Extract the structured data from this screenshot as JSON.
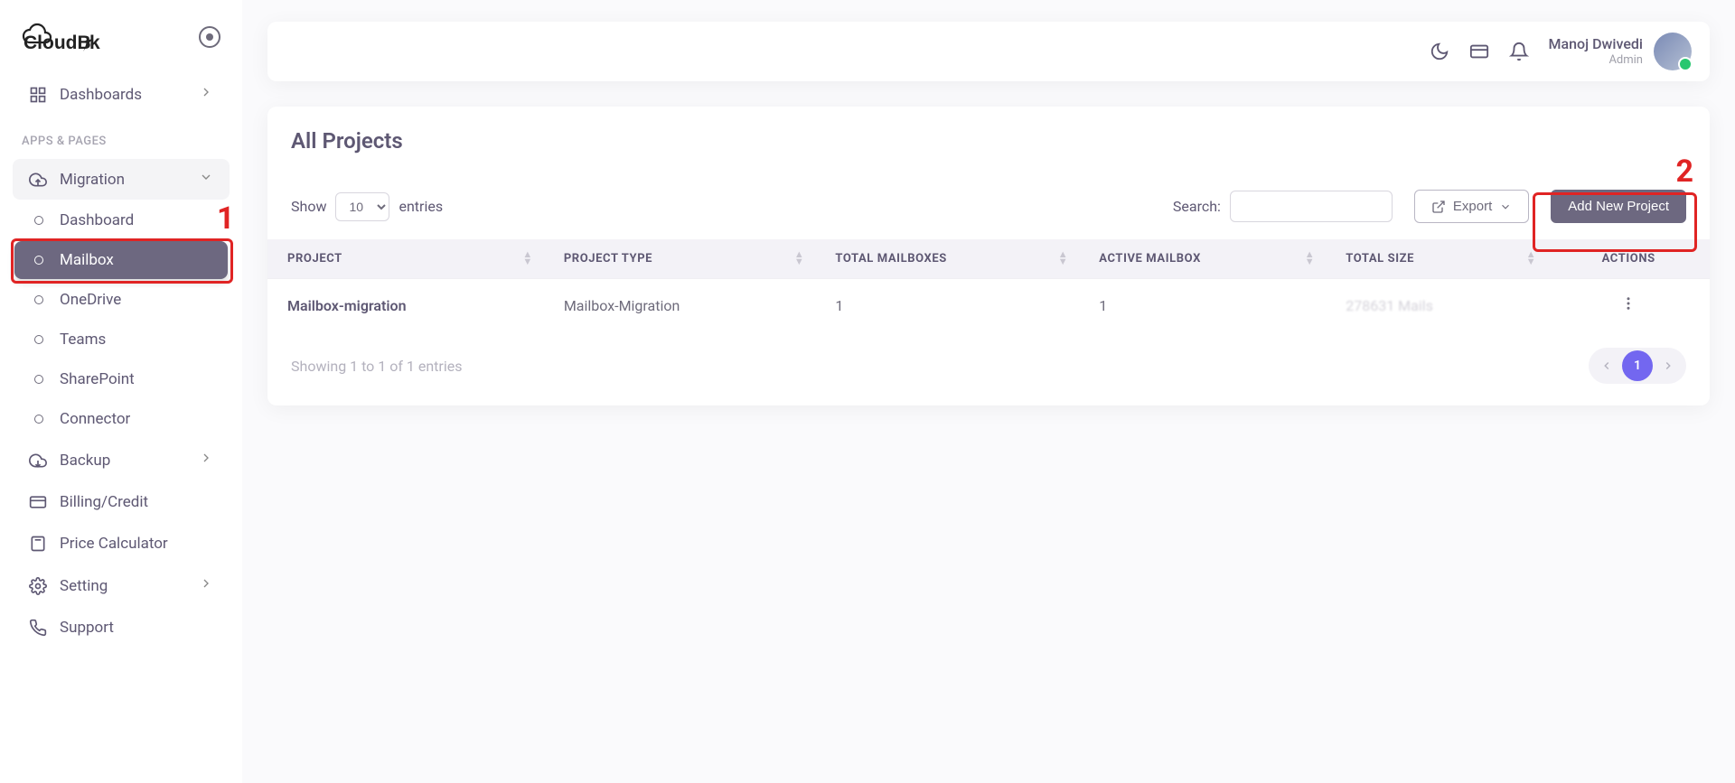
{
  "brand": {
    "name": "CloudBik"
  },
  "sidebar": {
    "dashboards": "Dashboards",
    "section_apps": "APPS & PAGES",
    "migration": {
      "label": "Migration",
      "children": [
        "Dashboard",
        "Mailbox",
        "OneDrive",
        "Teams",
        "SharePoint",
        "Connector"
      ]
    },
    "backup": "Backup",
    "billing": "Billing/Credit",
    "price_calc": "Price Calculator",
    "setting": "Setting",
    "support": "Support"
  },
  "header": {
    "user_name": "Manoj Dwivedi",
    "user_role": "Admin"
  },
  "card": {
    "title": "All Projects",
    "show_label": "Show",
    "entries_label": "entries",
    "entries_value": "10",
    "search_label": "Search:",
    "export_label": "Export",
    "add_label": "Add New Project",
    "columns": [
      "PROJECT",
      "PROJECT TYPE",
      "TOTAL MAILBOXES",
      "ACTIVE MAILBOX",
      "TOTAL SIZE",
      "ACTIONS"
    ],
    "rows": [
      {
        "project": "Mailbox-migration",
        "type": "Mailbox-Migration",
        "total_mailboxes": "1",
        "active_mailbox": "1",
        "total_size": "278631 Mails"
      }
    ],
    "showing_text": "Showing 1 to 1 of 1 entries",
    "page": "1"
  },
  "annotations": {
    "one": "1",
    "two": "2"
  }
}
